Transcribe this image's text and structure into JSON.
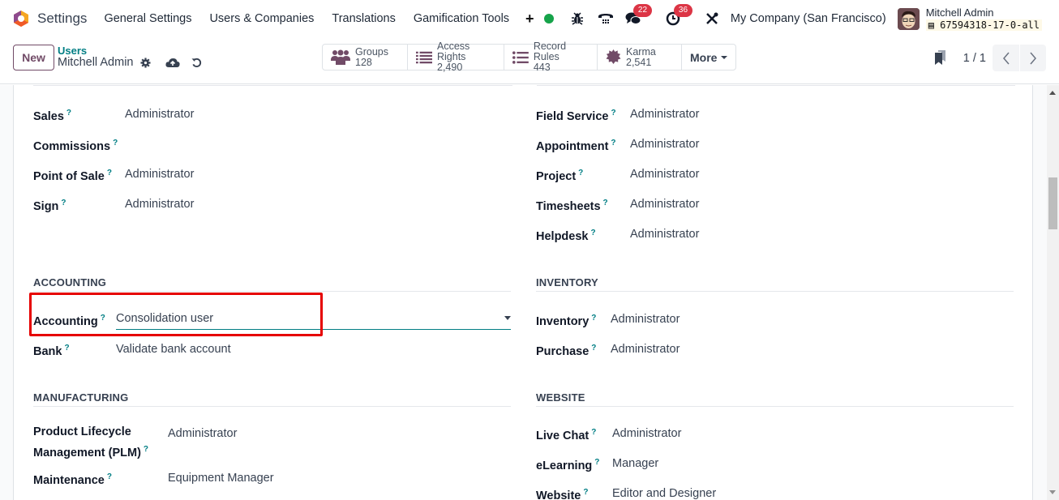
{
  "navbar": {
    "app_title": "Settings",
    "menu": [
      "General Settings",
      "Users & Companies",
      "Translations",
      "Gamification Tools"
    ],
    "add_label": "+",
    "systray": {
      "presence_status_color": "#16a34a",
      "messages_count": "22",
      "activities_count": "36",
      "company": "My Company (San Francisco)",
      "user_name": "Mitchell Admin",
      "database": "67594318-17-0-all"
    }
  },
  "control_panel": {
    "new_label": "New",
    "breadcrumb_parent": "Users",
    "breadcrumb_current": "Mitchell Admin",
    "smart_buttons": [
      {
        "label": "Groups",
        "value": "128",
        "icon": "users-icon"
      },
      {
        "label": "Access Rights",
        "value": "2,490",
        "icon": "list-icon"
      },
      {
        "label": "Record Rules",
        "value": "443",
        "icon": "list-ul-icon"
      },
      {
        "label": "Karma",
        "value": "2,541",
        "icon": "certificate-icon"
      }
    ],
    "more_label": "More",
    "pager": "1 / 1"
  },
  "form": {
    "left_top": [
      {
        "label": "Sales",
        "value": "Administrator"
      },
      {
        "label": "Commissions",
        "value": ""
      },
      {
        "label": "Point of Sale",
        "value": "Administrator"
      },
      {
        "label": "Sign",
        "value": "Administrator"
      }
    ],
    "right_top": [
      {
        "label": "Field Service",
        "value": "Administrator"
      },
      {
        "label": "Appointment",
        "value": "Administrator"
      },
      {
        "label": "Project",
        "value": "Administrator"
      },
      {
        "label": "Timesheets",
        "value": "Administrator"
      },
      {
        "label": "Helpdesk",
        "value": "Administrator"
      }
    ],
    "accounting": {
      "title": "ACCOUNTING",
      "fields": [
        {
          "label": "Accounting",
          "value": "Consolidation user"
        },
        {
          "label": "Bank",
          "value": "Validate bank account"
        }
      ]
    },
    "inventory": {
      "title": "INVENTORY",
      "fields": [
        {
          "label": "Inventory",
          "value": "Administrator"
        },
        {
          "label": "Purchase",
          "value": "Administrator"
        }
      ]
    },
    "manufacturing": {
      "title": "MANUFACTURING",
      "fields": [
        {
          "label_line1": "Product Lifecycle",
          "label_line2": "Management (PLM)",
          "value": "Administrator"
        },
        {
          "label": "Maintenance",
          "value": "Equipment Manager"
        }
      ]
    },
    "website": {
      "title": "WEBSITE",
      "fields": [
        {
          "label": "Live Chat",
          "value": "Administrator"
        },
        {
          "label": "eLearning",
          "value": "Manager"
        },
        {
          "label": "Website",
          "value": "Editor and Designer"
        }
      ]
    },
    "help_mark": "?"
  },
  "colors": {
    "brand": "#714b67",
    "link": "#017e84",
    "highlight": "#e60000",
    "badge": "#dc3545"
  }
}
